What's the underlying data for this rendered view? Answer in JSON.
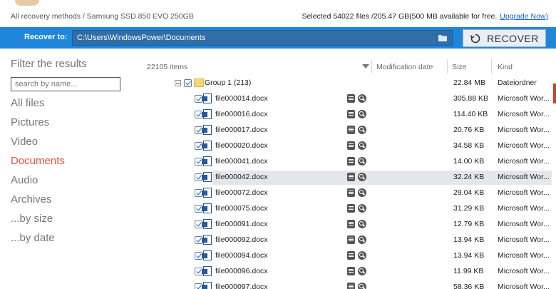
{
  "topbar": {
    "breadcrumb": "All recovery methods / Samsung SSD 850 EVO 250GB",
    "selection_info": "Selected 54022 files /205.47 GB(500 MB available for free.",
    "upgrade_link": "Upgrade Now)"
  },
  "recover": {
    "label": "Recover to:",
    "path": "C:\\Users\\WindowsPower\\Documents",
    "button_label": "RECOVER"
  },
  "filter": {
    "title": "Filter the results",
    "search_placeholder": "search by name...",
    "items": [
      {
        "label": "All files",
        "active": false
      },
      {
        "label": "Pictures",
        "active": false
      },
      {
        "label": "Video",
        "active": false
      },
      {
        "label": "Documents",
        "active": true
      },
      {
        "label": "Audio",
        "active": false
      },
      {
        "label": "Archives",
        "active": false
      },
      {
        "label": "...by size",
        "active": false
      },
      {
        "label": "...by date",
        "active": false
      }
    ]
  },
  "list": {
    "item_count": "22105 items",
    "columns": {
      "modified": "Modification date",
      "size": "Size",
      "kind": "Kind"
    },
    "group": {
      "name": "Group 1 (213)",
      "size": "22.84 MB",
      "kind": "Dateiordner"
    },
    "files": [
      {
        "name": "file000014.docx",
        "size": "305.88 KB",
        "kind": "Microsoft Wor...",
        "selected": false
      },
      {
        "name": "file000016.docx",
        "size": "114.40 KB",
        "kind": "Microsoft Wor...",
        "selected": false
      },
      {
        "name": "file000017.docx",
        "size": "20.76 KB",
        "kind": "Microsoft Wor...",
        "selected": false
      },
      {
        "name": "file000020.docx",
        "size": "34.58 KB",
        "kind": "Microsoft Wor...",
        "selected": false
      },
      {
        "name": "file000041.docx",
        "size": "14.00 KB",
        "kind": "Microsoft Wor...",
        "selected": false
      },
      {
        "name": "file000042.docx",
        "size": "32.24 KB",
        "kind": "Microsoft Wor...",
        "selected": true
      },
      {
        "name": "file000072.docx",
        "size": "29.04 KB",
        "kind": "Microsoft Wor...",
        "selected": false
      },
      {
        "name": "file000075.docx",
        "size": "31.29 KB",
        "kind": "Microsoft Wor...",
        "selected": false
      },
      {
        "name": "file000091.docx",
        "size": "12.79 KB",
        "kind": "Microsoft Wor...",
        "selected": false
      },
      {
        "name": "file000092.docx",
        "size": "13.94 KB",
        "kind": "Microsoft Wor...",
        "selected": false
      },
      {
        "name": "file000094.docx",
        "size": "13.94 KB",
        "kind": "Microsoft Wor...",
        "selected": false
      },
      {
        "name": "file000096.docx",
        "size": "11.99 KB",
        "kind": "Microsoft Wor...",
        "selected": false
      },
      {
        "name": "file000097.docx",
        "size": "58.36 KB",
        "kind": "Microsoft Wor...",
        "selected": false
      }
    ]
  },
  "colors": {
    "accent_bar": "#1f86d9",
    "active_filter": "#e8553e",
    "link": "#1565c0"
  },
  "icons": [
    "folder-browse-icon",
    "recover-icon",
    "sort-arrow-icon",
    "checkbox-icon",
    "folder-icon",
    "word-doc-icon",
    "preview-icon",
    "search-preview-icon"
  ]
}
